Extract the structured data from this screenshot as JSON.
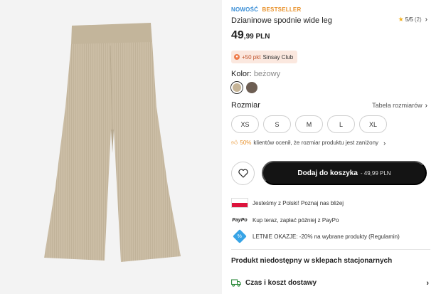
{
  "product": {
    "badge_new": "NOWOŚĆ",
    "badge_bestseller": "BESTSELLER",
    "title": "Dzianinowe spodnie wide leg",
    "price_main": "49",
    "price_fraction": ",99 PLN",
    "rating_value": "5/5",
    "rating_count": "(2)",
    "image_alt": "beige knitted wide-leg pants"
  },
  "club": {
    "points": "+50 pkt",
    "name": "Sinsay Club"
  },
  "color": {
    "label": "Kolor:",
    "value": "beżowy",
    "swatches": [
      "#c6b497",
      "#6d5e53"
    ]
  },
  "size": {
    "label": "Rozmiar",
    "guide_label": "Tabela rozmiarów",
    "options": [
      "XS",
      "S",
      "M",
      "L",
      "XL"
    ]
  },
  "fit": {
    "percent": "50%",
    "text": "klientów ocenił, że rozmiar produktu jest zaniżony"
  },
  "cart": {
    "add_label": "Dodaj do koszyka",
    "add_price": "- 49,99 PLN"
  },
  "promos": [
    {
      "icon": "poland-flag-icon",
      "text": "Jesteśmy z Polski! Poznaj nas bliżej"
    },
    {
      "icon": "paypo-logo",
      "text": "Kup teraz, zapłać później z PayPo",
      "logo_text": "PayPo"
    },
    {
      "icon": "discount-tag-icon",
      "text": "LETNIE OKAZJE: -20% na wybrane produkty (Regulamin)",
      "symbol": "%"
    }
  ],
  "availability": {
    "text": "Produkt niedostępny w sklepach stacjonarnych"
  },
  "delivery": {
    "label": "Czas i koszt dostawy"
  },
  "colors": {
    "accent_new": "#3b8fd6",
    "accent_bestseller": "#e8912a",
    "button_dark": "#141414",
    "delivery_green": "#2c8a3b"
  }
}
